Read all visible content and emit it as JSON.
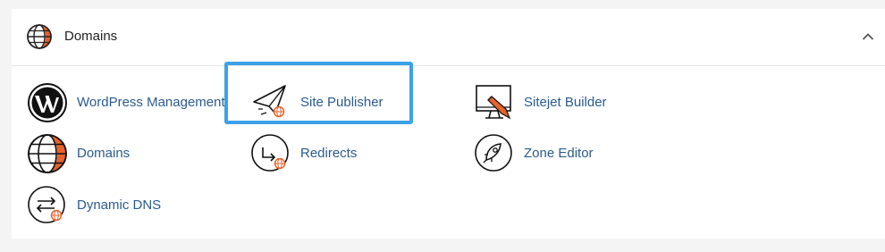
{
  "section": {
    "title": "Domains",
    "icon": "globe-icon"
  },
  "items": [
    {
      "label": "WordPress Management",
      "icon": "wordpress-icon"
    },
    {
      "label": "Site Publisher",
      "icon": "paper-plane-icon"
    },
    {
      "label": "Sitejet Builder",
      "icon": "monitor-pen-icon"
    },
    {
      "label": "Domains",
      "icon": "globe-icon"
    },
    {
      "label": "Redirects",
      "icon": "redirect-arrow-icon"
    },
    {
      "label": "Zone Editor",
      "icon": "rocket-icon"
    },
    {
      "label": "Dynamic DNS",
      "icon": "exchange-arrows-icon"
    }
  ],
  "colors": {
    "link": "#2a5b8f",
    "accent": "#e8622a",
    "highlight": "#3da1e8"
  }
}
